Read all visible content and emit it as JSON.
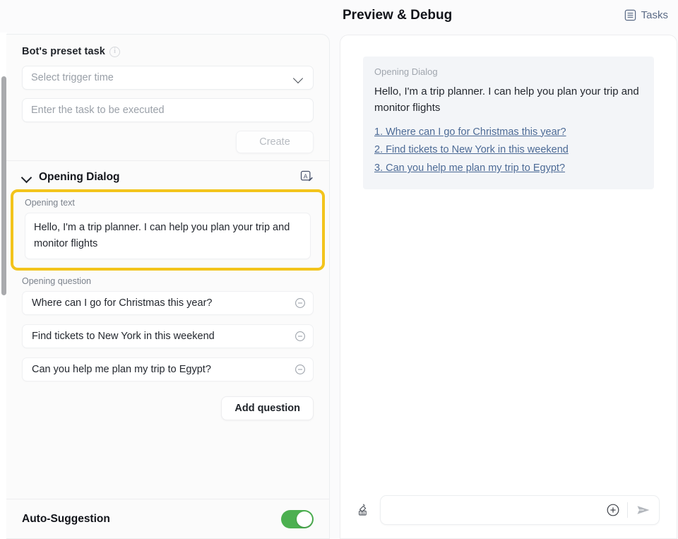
{
  "left_panel": {
    "preset_task": {
      "label": "Bot's preset task",
      "info_icon": "info-circle-icon",
      "trigger_select_placeholder": "Select trigger time",
      "trigger_select_value": "",
      "task_input_placeholder": "Enter the task to be executed",
      "task_input_value": "",
      "create_label": "Create"
    },
    "opening_dialog": {
      "title": "Opening Dialog",
      "collapse_icon": "chevron-down-icon",
      "translate_icon": "translate-edit-icon",
      "opening_text_label": "Opening text",
      "opening_text_value": "Hello, I'm a trip planner. I can help you plan your trip and monitor flights",
      "opening_question_label": "Opening question",
      "questions": [
        "Where can I go for Christmas this year?",
        "Find tickets to New York in this weekend",
        "Can you help me plan my trip to Egypt?"
      ],
      "remove_icon": "minus-circle-icon",
      "add_question_label": "Add question"
    },
    "auto_suggestion": {
      "label": "Auto-Suggestion",
      "enabled": true
    }
  },
  "right_panel": {
    "title": "Preview & Debug",
    "tasks_label": "Tasks",
    "tasks_icon": "tasks-list-icon",
    "message": {
      "tag": "Opening Dialog",
      "text": "Hello, I'm a trip planner. I can help you plan your trip and monitor flights",
      "links": [
        "1. Where can I go for Christmas this year?",
        "2. Find tickets to New York in this weekend",
        "3. Can you help me plan my trip to Egypt?"
      ]
    },
    "composer": {
      "clear_icon": "broom-icon",
      "input_placeholder": "",
      "input_value": "",
      "attach_icon": "plus-circle-icon",
      "send_icon": "send-arrow-icon"
    }
  },
  "colors": {
    "highlight": "#f3c41c",
    "toggle_on": "#4cb050",
    "link": "#4d6b96",
    "accent_text": "#5b6b86"
  }
}
